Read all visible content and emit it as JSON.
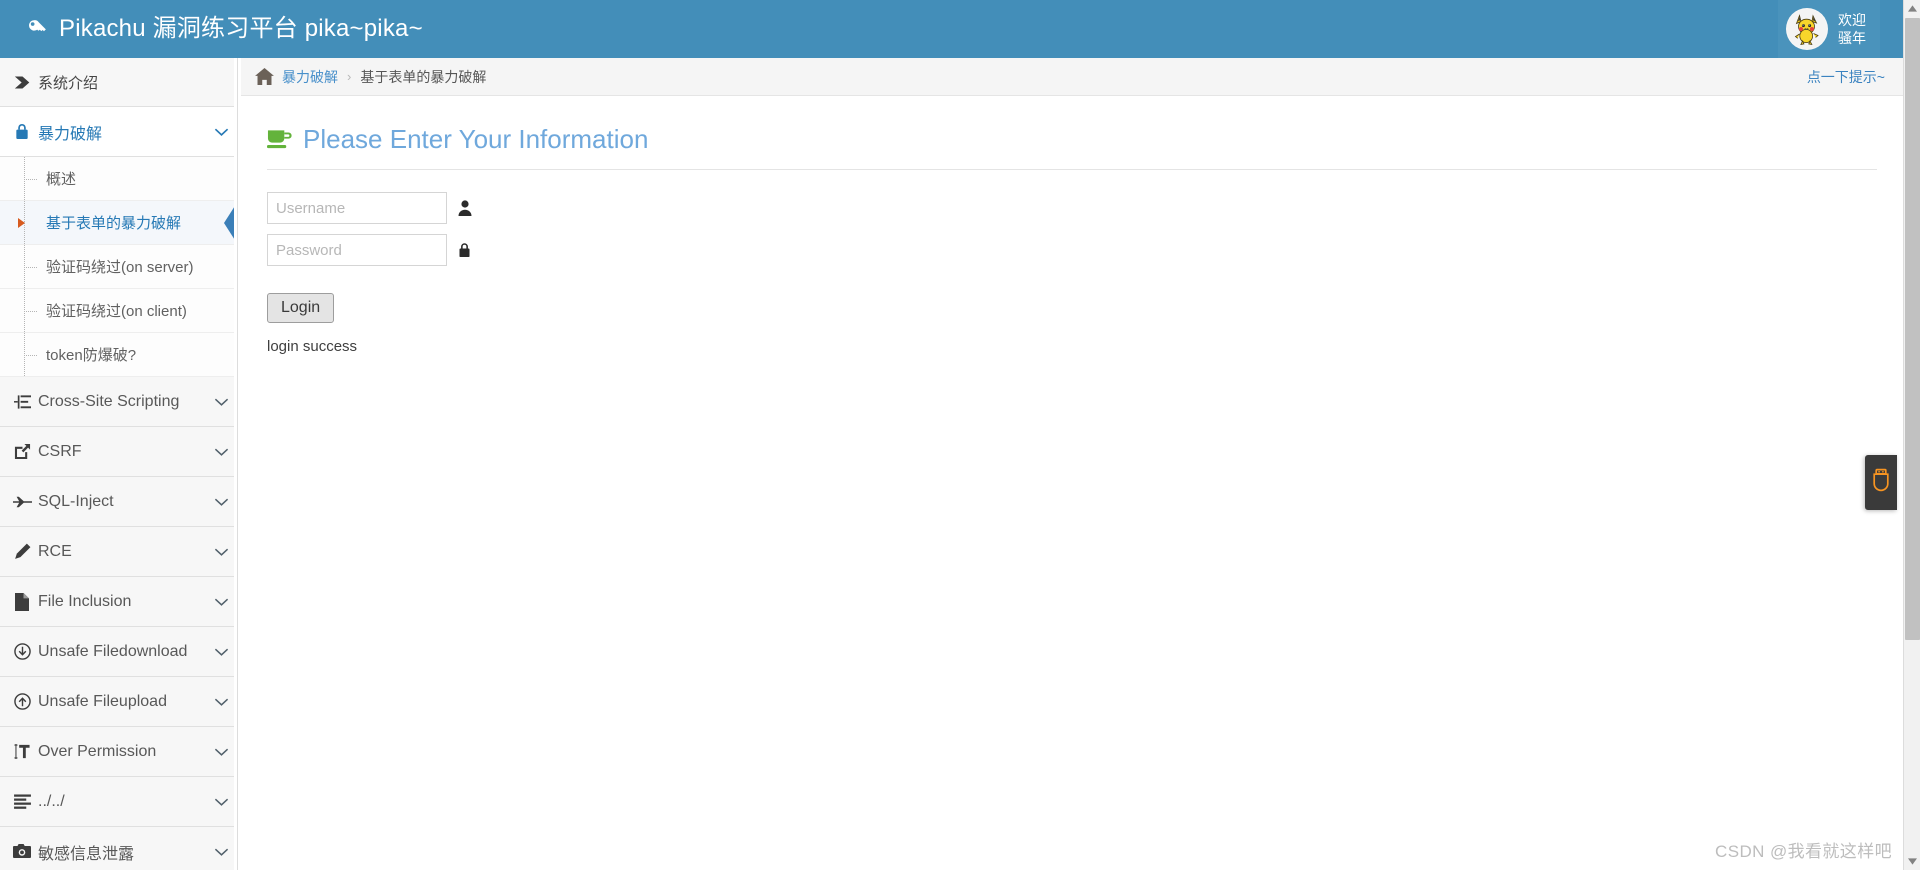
{
  "header": {
    "brand_icon": "key-icon",
    "title": "Pikachu 漏洞练习平台 pika~pika~",
    "user": {
      "avatar_icon": "pikachu-avatar",
      "line1": "欢迎",
      "line2": "骚年"
    },
    "bg_color": "#438eb9"
  },
  "sidebar": {
    "intro": {
      "label": "系统介绍",
      "icon": "tag-icon"
    },
    "groups": [
      {
        "label": "暴力破解",
        "icon": "lock-icon",
        "expanded": true,
        "caret": "chevron-down-icon",
        "items": [
          {
            "label": "概述",
            "active": false
          },
          {
            "label": "基于表单的暴力破解",
            "active": true
          },
          {
            "label": "验证码绕过(on server)",
            "active": false
          },
          {
            "label": "验证码绕过(on client)",
            "active": false
          },
          {
            "label": "token防爆破?",
            "active": false
          }
        ]
      },
      {
        "label": "Cross-Site Scripting",
        "icon": "xss-icon",
        "expanded": false,
        "caret": "chevron-down-icon"
      },
      {
        "label": "CSRF",
        "icon": "csrf-icon",
        "expanded": false,
        "caret": "chevron-down-icon"
      },
      {
        "label": "SQL-Inject",
        "icon": "plane-icon",
        "expanded": false,
        "caret": "chevron-down-icon"
      },
      {
        "label": "RCE",
        "icon": "pencil-icon",
        "expanded": false,
        "caret": "chevron-down-icon"
      },
      {
        "label": "File Inclusion",
        "icon": "file-icon",
        "expanded": false,
        "caret": "chevron-down-icon"
      },
      {
        "label": "Unsafe Filedownload",
        "icon": "download-icon",
        "expanded": false,
        "caret": "chevron-down-icon"
      },
      {
        "label": "Unsafe Fileupload",
        "icon": "upload-icon",
        "expanded": false,
        "caret": "chevron-down-icon"
      },
      {
        "label": "Over Permission",
        "icon": "text-height-icon",
        "expanded": false,
        "caret": "chevron-down-icon"
      },
      {
        "label": "../../",
        "icon": "align-left-icon",
        "expanded": false,
        "caret": "chevron-down-icon"
      },
      {
        "label": "敏感信息泄露",
        "icon": "camera-icon",
        "expanded": false,
        "caret": "chevron-down-icon"
      }
    ]
  },
  "breadcrumb": {
    "home_icon": "home-icon",
    "parent": "暴力破解",
    "separator": "›",
    "current": "基于表单的暴力破解",
    "hint_label": "点一下提示~"
  },
  "panel": {
    "icon": "coffee-cup-icon",
    "title": "Please Enter Your Information",
    "fields": [
      {
        "name": "username",
        "value": "",
        "placeholder": "Username",
        "icon": "user-icon",
        "type": "text"
      },
      {
        "name": "password",
        "value": "",
        "placeholder": "Password",
        "icon": "lock-icon",
        "type": "password"
      }
    ],
    "submit_label": "Login",
    "result_message": "login success"
  },
  "side_widget": {
    "icon": "usb-drive-icon",
    "color": "#f79421"
  },
  "scrollbar": {
    "up_icon": "caret-up-icon",
    "down_icon": "caret-down-icon"
  },
  "watermark": "CSDN @我看就这样吧"
}
